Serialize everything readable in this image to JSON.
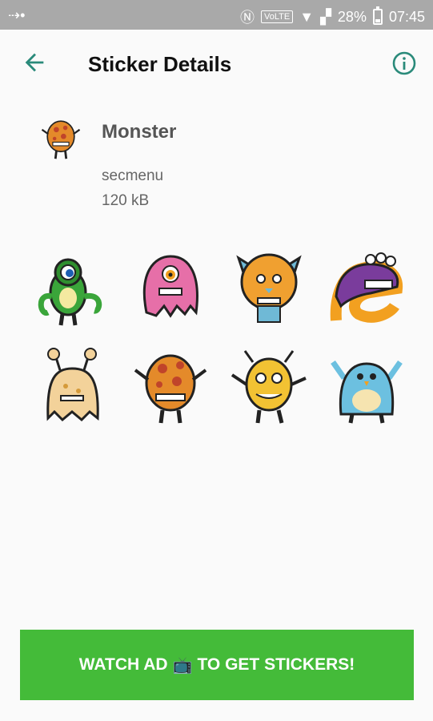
{
  "status_bar": {
    "battery_percent": "28%",
    "time": "07:45",
    "volte": "VoLTE"
  },
  "app_bar": {
    "title": "Sticker Details",
    "back_icon": "arrow-back-icon",
    "info_icon": "info-icon"
  },
  "pack": {
    "name": "Monster",
    "publisher": "secmenu",
    "size": "120 kB"
  },
  "stickers": [
    {
      "name": "green-cyclops-octopus",
      "color": "#3aa53a"
    },
    {
      "name": "pink-cyclops-blob",
      "color": "#e66fa8"
    },
    {
      "name": "orange-horned-monster",
      "color": "#f0a030"
    },
    {
      "name": "purple-worm-monster",
      "color": "#7a3c9c"
    },
    {
      "name": "tan-ghost-antennae",
      "color": "#f3d29a"
    },
    {
      "name": "orange-spotted-monster",
      "color": "#e48a2a"
    },
    {
      "name": "yellow-horned-monster",
      "color": "#f2c233"
    },
    {
      "name": "blue-furry-monster",
      "color": "#6cc0e0"
    }
  ],
  "cta": {
    "label_before": "WATCH AD",
    "label_after": "TO GET STICKERS!",
    "icon": "tv-emoji-icon",
    "color": "#44bb39"
  }
}
